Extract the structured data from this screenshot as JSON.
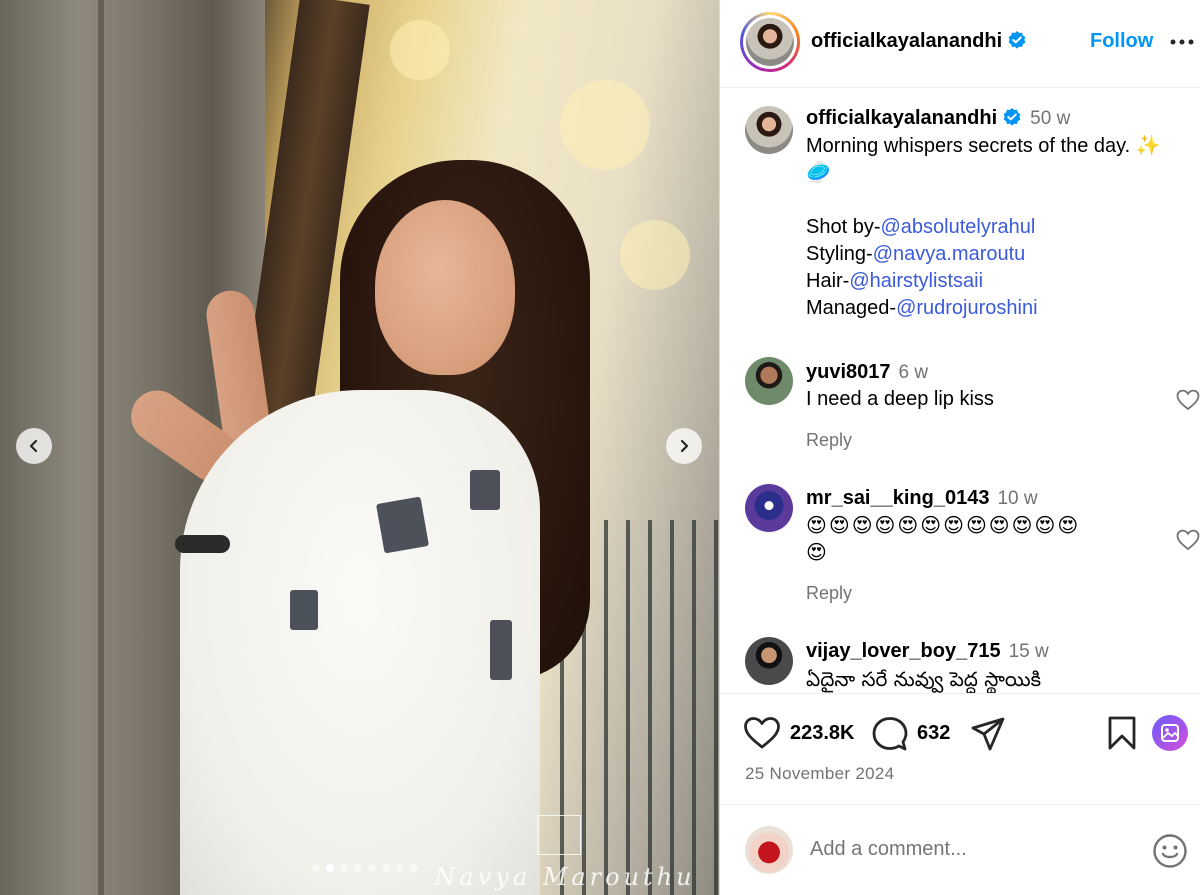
{
  "post": {
    "username": "officialkayalanandhi",
    "follow_label": "Follow",
    "caption_time": "50 w",
    "caption_lines": [
      {
        "text": "Morning whispers secrets of the day. ✨"
      },
      {
        "text": "🥏"
      },
      {
        "text": ""
      },
      {
        "prefix": "Shot by-",
        "mention": "@absolutelyrahul"
      },
      {
        "prefix": "Styling-",
        "mention": "@navya.maroutu"
      },
      {
        "prefix": "Hair-",
        "mention": "@hairstylistsaii"
      },
      {
        "prefix": "Managed-",
        "mention": "@rudrojuroshini"
      }
    ],
    "likes": "223.8K",
    "comments_count": "632",
    "date": "25 November 2024",
    "comment_placeholder": "Add a comment...",
    "watermark": "Navya Marouthu"
  },
  "comments": [
    {
      "username": "yuvi8017",
      "time": "6 w",
      "text": "I need a deep lip kiss",
      "reply_label": "Reply"
    },
    {
      "username": "mr_sai__king_0143",
      "time": "10 w",
      "text_line1": "😍😍😍😍😍😍😍😍😍😍😍😍",
      "text_line2": "😍",
      "reply_label": "Reply"
    },
    {
      "username": "vijay_lover_boy_715",
      "time": "15 w",
      "text": "ఏదైనా సరే నువ్వు పెద్ద స్థాయికి"
    }
  ],
  "carousel": {
    "total_slides": 8,
    "active_index": 1
  },
  "icons": [
    "verified-badge-icon",
    "more-icon",
    "chevron-left-icon",
    "chevron-right-icon",
    "heart-icon",
    "comment-icon",
    "share-icon",
    "bookmark-icon",
    "gallery-icon",
    "emoji-icon"
  ],
  "colors": {
    "follow": "#0095f6",
    "verified": "#0095f6",
    "mention": "#3b5bdb",
    "muted": "#737373",
    "border": "#dbdbdb"
  }
}
